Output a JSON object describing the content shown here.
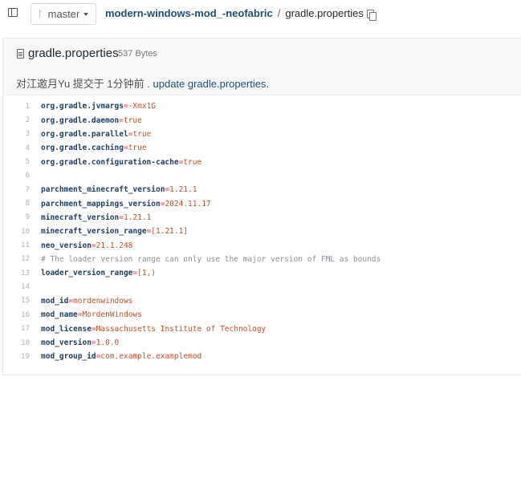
{
  "topbar": {
    "branch": "master",
    "repo": "modern-windows-mod_-neofabric",
    "separator": "/",
    "file": "gradle.properties"
  },
  "file_header": {
    "name": "gradle.properties",
    "size": "537 Bytes",
    "commit_prefix": "对江邀月Yu 提交于 1分钟前 .",
    "commit_message": "update gradle.properties."
  },
  "code_lines": [
    {
      "n": "1",
      "key": "org.gradle.jvmargs",
      "eq": "=",
      "val": "-Xmx1G",
      "cmt": ""
    },
    {
      "n": "2",
      "key": "org.gradle.daemon",
      "eq": "=",
      "val": "true",
      "cmt": ""
    },
    {
      "n": "3",
      "key": "org.gradle.parallel",
      "eq": "=",
      "val": "true",
      "cmt": ""
    },
    {
      "n": "4",
      "key": "org.gradle.caching",
      "eq": "=",
      "val": "true",
      "cmt": ""
    },
    {
      "n": "5",
      "key": "org.gradle.configuration-cache",
      "eq": "=",
      "val": "true",
      "cmt": ""
    },
    {
      "n": "6",
      "key": "",
      "eq": "",
      "val": "",
      "cmt": ""
    },
    {
      "n": "7",
      "key": "parchment_minecraft_version",
      "eq": "=",
      "val": "1.21.1",
      "cmt": ""
    },
    {
      "n": "8",
      "key": "parchment_mappings_version",
      "eq": "=",
      "val": "2024.11.17",
      "cmt": ""
    },
    {
      "n": "9",
      "key": "minecraft_version",
      "eq": "=",
      "val": "1.21.1",
      "cmt": ""
    },
    {
      "n": "10",
      "key": "minecraft_version_range",
      "eq": "=",
      "val": "[1.21.1]",
      "cmt": ""
    },
    {
      "n": "11",
      "key": "neo_version",
      "eq": "=",
      "val": "21.1.248",
      "cmt": ""
    },
    {
      "n": "12",
      "key": "",
      "eq": "",
      "val": "",
      "cmt": "# The loader version range can only use the major version of FML as bounds"
    },
    {
      "n": "13",
      "key": "loader_version_range",
      "eq": "=",
      "val": "[1,)",
      "cmt": ""
    },
    {
      "n": "14",
      "key": "",
      "eq": "",
      "val": "",
      "cmt": ""
    },
    {
      "n": "15",
      "key": "mod_id",
      "eq": "=",
      "val": "mordenwindows",
      "cmt": ""
    },
    {
      "n": "16",
      "key": "mod_name",
      "eq": "=",
      "val": "MordenWindows",
      "cmt": ""
    },
    {
      "n": "17",
      "key": "mod_license",
      "eq": "=",
      "val": "Massachusetts Institute of Technology",
      "cmt": ""
    },
    {
      "n": "18",
      "key": "mod_version",
      "eq": "=",
      "val": "1.0.0",
      "cmt": ""
    },
    {
      "n": "19",
      "key": "mod_group_id",
      "eq": "=",
      "val": "com.example.examplemod",
      "cmt": ""
    }
  ]
}
